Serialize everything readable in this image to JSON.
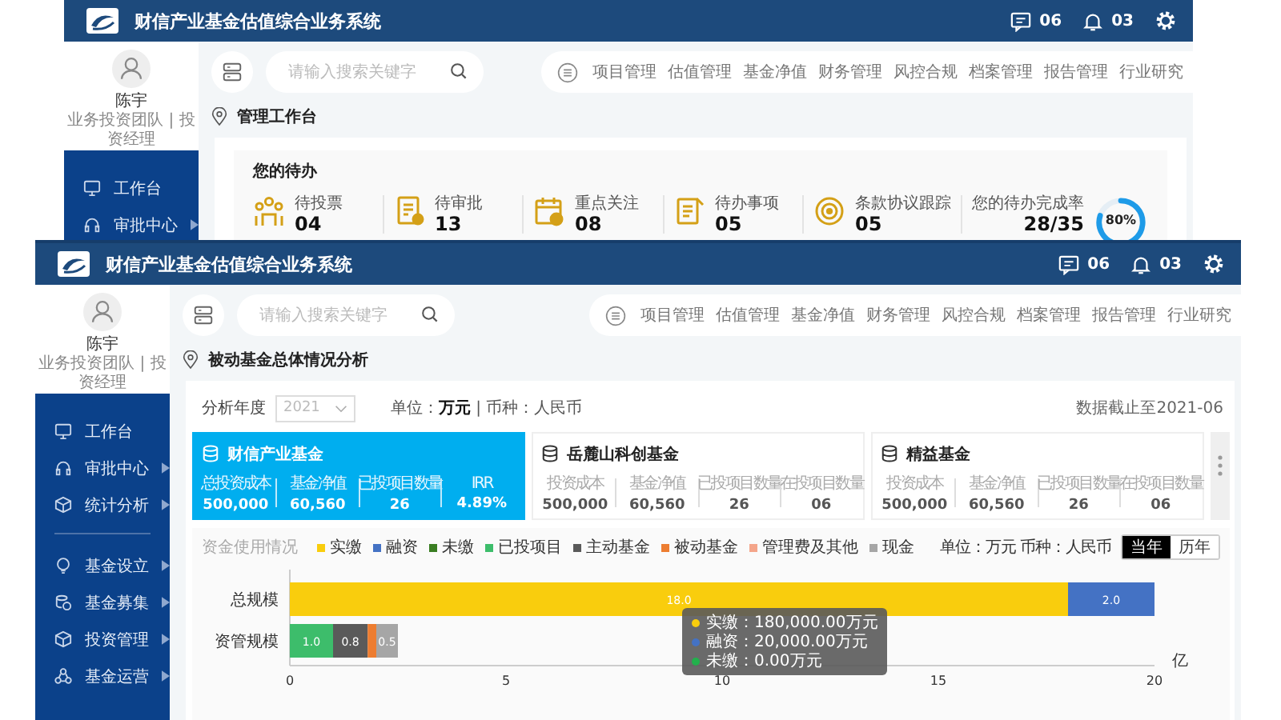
{
  "windows": [
    {
      "kind": "todo",
      "title": "财信产业基金估值综合业务系统",
      "messages": "06",
      "notifications": "03",
      "user": {
        "name": "陈宇",
        "role": "业务投资团队 | 投资经理"
      },
      "menu_sections": [
        {
          "items": [
            {
              "label": "工作台",
              "has_submenu": false
            },
            {
              "label": "审批中心",
              "has_submenu": true
            }
          ]
        }
      ],
      "search": {
        "placeholder": "请输入搜索关键字"
      },
      "nav": [
        "项目管理",
        "估值管理",
        "基金净值",
        "财务管理",
        "风控合规",
        "档案管理",
        "报告管理",
        "行业研究"
      ],
      "breadcrumb": "管理工作台",
      "todo": {
        "title": "您的待办",
        "items": [
          {
            "label": "待投票",
            "count": "04"
          },
          {
            "label": "待审批",
            "count": "13"
          },
          {
            "label": "重点关注",
            "count": "08"
          },
          {
            "label": "待办事项",
            "count": "05"
          },
          {
            "label": "条款协议跟踪",
            "count": "05"
          }
        ],
        "completion": {
          "label": "您的待办完成率",
          "value": "28/35",
          "level": 0.8,
          "percent": "80%"
        }
      }
    },
    {
      "kind": "analysis",
      "title": "财信产业基金估值综合业务系统",
      "messages": "06",
      "notifications": "03",
      "user": {
        "name": "陈宇",
        "role": "业务投资团队 | 投资经理"
      },
      "menu_sections": [
        {
          "items": [
            {
              "label": "工作台",
              "has_submenu": false
            },
            {
              "label": "审批中心",
              "has_submenu": true
            },
            {
              "label": "统计分析",
              "has_submenu": true
            }
          ]
        },
        {
          "items": [
            {
              "label": "基金设立",
              "has_submenu": true
            },
            {
              "label": "基金募集",
              "has_submenu": true
            },
            {
              "label": "投资管理",
              "has_submenu": true
            },
            {
              "label": "基金运营",
              "has_submenu": true
            }
          ]
        }
      ],
      "search": {
        "placeholder": "请输入搜索关键字"
      },
      "nav": [
        "项目管理",
        "估值管理",
        "基金净值",
        "财务管理",
        "风控合规",
        "档案管理",
        "报告管理",
        "行业研究"
      ],
      "breadcrumb": "被动基金总体情况分析",
      "filter": {
        "label": "分析年度",
        "year": "2021",
        "unit_text": "单位：**万元** | 币种：人民币",
        "as_of": "数据截止至2021-06"
      },
      "fund_cards": [
        {
          "title": "财信产业基金",
          "selected": true,
          "stats": [
            {
              "label": "总投资成本",
              "value": "500,000"
            },
            {
              "label": "基金净值",
              "value": "60,560"
            },
            {
              "label": "已投项目数量",
              "value": "26"
            },
            {
              "label": "IRR",
              "value": "4.89%"
            }
          ]
        },
        {
          "title": "岳麓山科创基金",
          "selected": false,
          "stats": [
            {
              "label": "投资成本",
              "value": "500,000"
            },
            {
              "label": "基金净值",
              "value": "60,560"
            },
            {
              "label": "已投项目数量",
              "value": "26"
            },
            {
              "label": "在投项目数量",
              "value": "06"
            }
          ]
        },
        {
          "title": "精益基金",
          "selected": false,
          "stats": [
            {
              "label": "投资成本",
              "value": "500,000"
            },
            {
              "label": "基金净值",
              "value": "60,560"
            },
            {
              "label": "已投项目数量",
              "value": "26"
            },
            {
              "label": "在投项目数量",
              "value": "06"
            }
          ]
        }
      ],
      "chart_panel": {
        "title": "资金使用情况",
        "unit_note": "单位：万元  币种：人民币",
        "toggle": [
          {
            "label": "当年",
            "selected": true
          },
          {
            "label": "历年",
            "selected": false
          }
        ],
        "tooltip": [
          {
            "text": "实缴：180,000.00万元",
            "color": "#f9cd0d"
          },
          {
            "text": "融资：20,000.00万元",
            "color": "#4472c4"
          },
          {
            "text": "未缴：0.00万元",
            "color": "#22b14c"
          }
        ],
        "chart_data": {
          "type": "bar",
          "orientation": "horizontal",
          "stacked": true,
          "categories": [
            "总规模",
            "资管规模"
          ],
          "xlabel": "亿",
          "xlim": [
            0,
            20
          ],
          "xticks": [
            0,
            5,
            10,
            15,
            20
          ],
          "series": [
            {
              "name": "实缴",
              "color": "#f9cd0d",
              "values": [
                18.0,
                null
              ],
              "value_labels": [
                "18.0",
                null
              ]
            },
            {
              "name": "融资",
              "color": "#4472c4",
              "values": [
                2.0,
                null
              ],
              "value_labels": [
                "2.0",
                null
              ]
            },
            {
              "name": "未缴",
              "color": "#3a7d22",
              "values": [
                0,
                null
              ],
              "value_labels": [
                null,
                null
              ]
            },
            {
              "name": "已投项目",
              "color": "#3dbd6b",
              "values": [
                null,
                1.0
              ],
              "value_labels": [
                null,
                "1.0"
              ]
            },
            {
              "name": "主动基金",
              "color": "#5a5a5a",
              "values": [
                null,
                0.8
              ],
              "value_labels": [
                null,
                "0.8"
              ]
            },
            {
              "name": "被动基金",
              "color": "#ed7d31",
              "values": [
                null,
                0.2
              ],
              "value_labels": [
                null,
                null
              ]
            },
            {
              "name": "管理费及其他",
              "color": "#f4a58a",
              "values": [
                null,
                null
              ],
              "value_labels": [
                null,
                null
              ]
            },
            {
              "name": "现金",
              "color": "#a6a6a6",
              "values": [
                null,
                0.5
              ],
              "value_labels": [
                null,
                "0.5"
              ]
            }
          ]
        }
      }
    }
  ]
}
